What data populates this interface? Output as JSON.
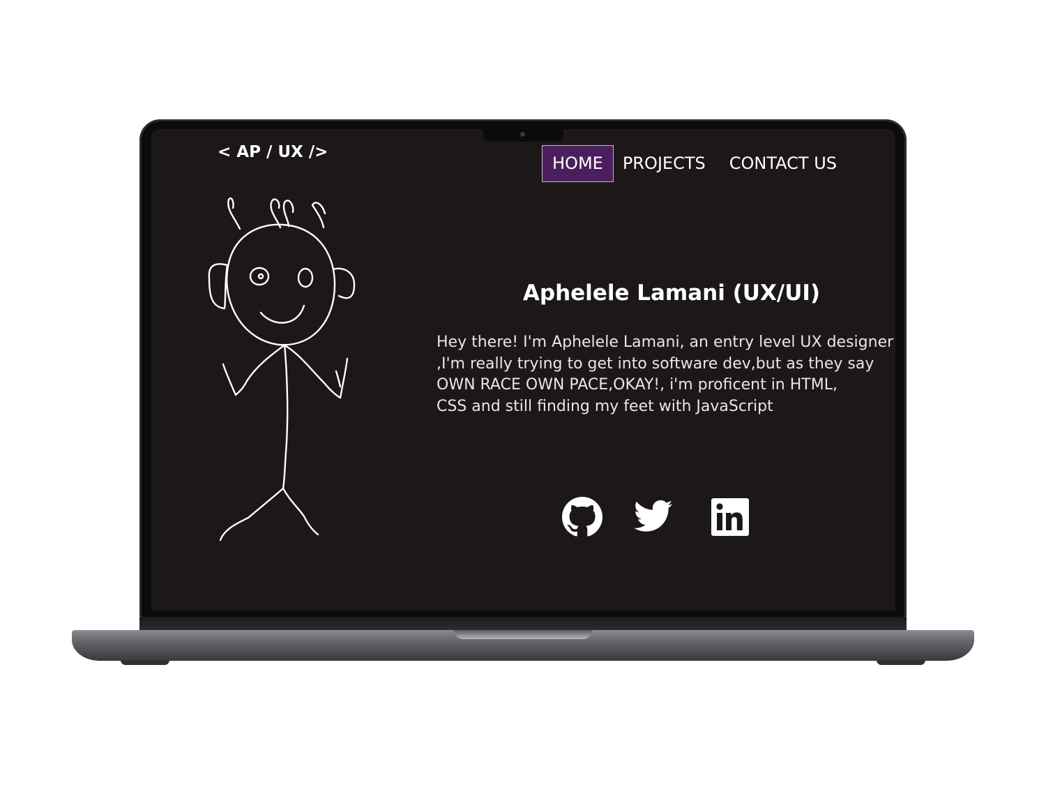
{
  "site": {
    "logo_text": "< AP / UX />"
  },
  "nav": {
    "items": [
      {
        "label": "HOME",
        "active": true
      },
      {
        "label": "PROJECTS",
        "active": false
      },
      {
        "label": "CONTACT US",
        "active": false
      }
    ],
    "active_color": "#4b1f5e"
  },
  "hero": {
    "name": "Aphelele Lamani (UX/UI)",
    "intro": "Hey there! I'm Aphelele Lamani, an entry level UX designer\n,I'm really trying to get into software dev,but as they say\nOWN RACE OWN PACE,OKAY!, i'm proficent in HTML,\nCSS and still finding my feet with JavaScript",
    "illustration": "stick-figure-doodle"
  },
  "social": {
    "icons": [
      "github-icon",
      "twitter-icon",
      "linkedin-icon"
    ]
  },
  "colors": {
    "screen_background": "#1c1818",
    "text": "#ffffff",
    "accent": "#4b1f5e"
  }
}
